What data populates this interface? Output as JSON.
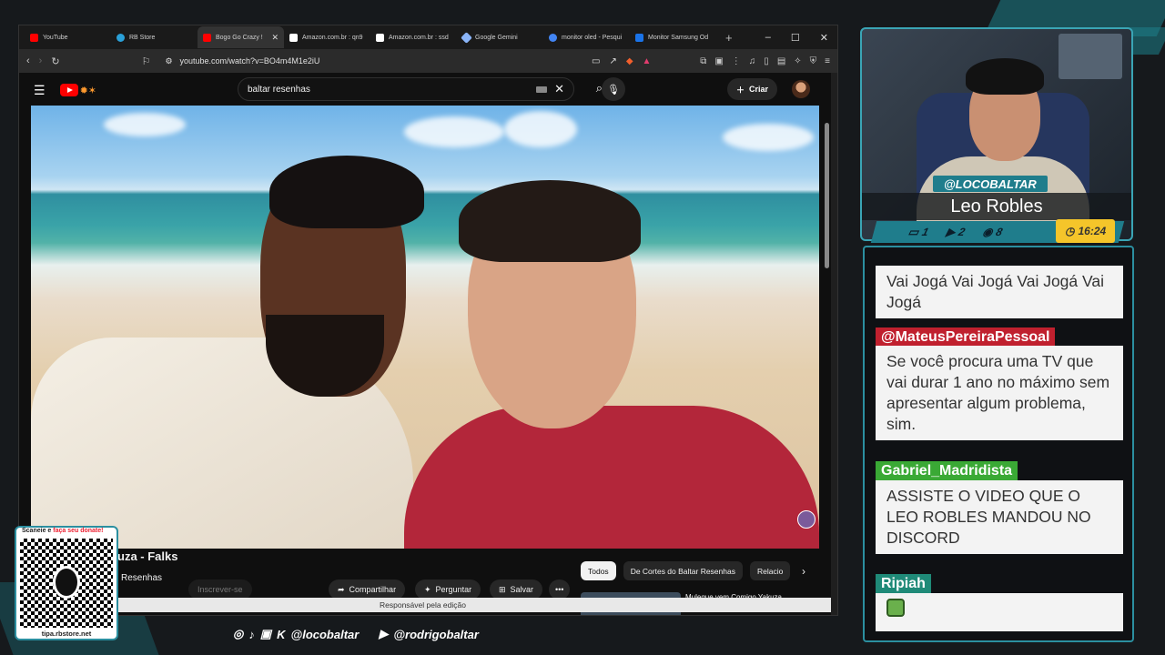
{
  "browser": {
    "tabs": [
      {
        "label": "YouTube",
        "color": "#ff0000"
      },
      {
        "label": "RB Store",
        "color": "#2aa0d8"
      },
      {
        "label": "Bogo Go Crazy !",
        "color": "#ff0000"
      },
      {
        "label": "Amazon.com.br : qn9",
        "color": "#ffffff"
      },
      {
        "label": "Amazon.com.br : ssd",
        "color": "#ffffff"
      },
      {
        "label": "Google Gemini",
        "color": "#8ab4f8"
      },
      {
        "label": "monitor oled - Pesqui",
        "color": "#4285f4"
      },
      {
        "label": "Monitor Samsung Od",
        "color": "#1a73e8"
      }
    ],
    "url": "youtube.com/watch?v=BO4m4M1e2iU"
  },
  "youtube": {
    "search_query": "baltar resenhas",
    "create_label": "Criar",
    "video_title": "uza - Falks",
    "channel_name": "Resenhas",
    "subscribe_label": "Inscrever-se",
    "actions": {
      "share": "Compartilhar",
      "ask": "Perguntar",
      "save": "Salvar"
    },
    "chips": [
      "Todos",
      "De Cortes do Baltar Resenhas",
      "Relacio"
    ],
    "reco_title": "Muleque vem Comigo Yakuza",
    "edit_bar": "Responsável pela edição"
  },
  "stream": {
    "handle": "@LOCOBALTAR",
    "streamer_name": "Leo Robles",
    "stats": {
      "messages": "1",
      "youtube": "2",
      "viewers": "8"
    },
    "timer": "16:24",
    "chat": [
      {
        "user": "",
        "text": "Vai Jogá Vai Jogá Vai Jogá Vai Jogá"
      },
      {
        "user": "@MateusPereiraPessoal",
        "user_color": "#c0202e",
        "text": "Se você procura uma TV que vai durar 1 ano no máximo sem apresentar algum problema, sim."
      },
      {
        "user": "Gabriel_Madridista",
        "user_color": "#3aa935",
        "text": "ASSISTE O VIDEO QUE O LEO ROBLES MANDOU NO DISCORD"
      },
      {
        "user": "Ripiah",
        "user_color": "#1f8a78",
        "text": ""
      }
    ],
    "socials": {
      "handle1": "@locobaltar",
      "handle2": "@rodrigobaltar"
    },
    "qr": {
      "label_a": "Scaneie e ",
      "label_b": "faça seu donate!",
      "url": "tipa.rbstore.net"
    }
  }
}
